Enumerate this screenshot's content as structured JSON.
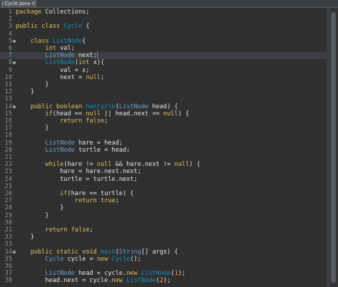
{
  "tab": {
    "title": "Cycle.java",
    "close_glyph": "✕"
  },
  "editor": {
    "current_line": 7,
    "lines": [
      {
        "n": "1",
        "fold": false,
        "tokens": [
          [
            "kw",
            "package"
          ],
          [
            "vr",
            " Collections;"
          ]
        ]
      },
      {
        "n": "2",
        "fold": false,
        "tokens": []
      },
      {
        "n": "3",
        "fold": false,
        "tokens": [
          [
            "kw",
            "public class"
          ],
          [
            "vr",
            " "
          ],
          [
            "cls",
            "Cycle"
          ],
          [
            "vr",
            " {"
          ]
        ]
      },
      {
        "n": "4",
        "fold": false,
        "tokens": []
      },
      {
        "n": "5",
        "fold": true,
        "tokens": [
          [
            "vr",
            "    "
          ],
          [
            "kw",
            "class"
          ],
          [
            "vr",
            " "
          ],
          [
            "cls",
            "ListNode"
          ],
          [
            "vr",
            "{"
          ]
        ]
      },
      {
        "n": "6",
        "fold": false,
        "tokens": [
          [
            "vr",
            "        "
          ],
          [
            "kw",
            "int"
          ],
          [
            "vr",
            " val;"
          ]
        ]
      },
      {
        "n": "7",
        "fold": false,
        "tokens": [
          [
            "vr",
            "        "
          ],
          [
            "ty",
            "ListNode"
          ],
          [
            "vr",
            " next;"
          ]
        ]
      },
      {
        "n": "8",
        "fold": true,
        "tokens": [
          [
            "vr",
            "        "
          ],
          [
            "cls",
            "ListNode"
          ],
          [
            "vr",
            "("
          ],
          [
            "kw",
            "int"
          ],
          [
            "vr",
            " x){"
          ]
        ]
      },
      {
        "n": "9",
        "fold": false,
        "tokens": [
          [
            "vr",
            "            val = x;"
          ]
        ]
      },
      {
        "n": "10",
        "fold": false,
        "tokens": [
          [
            "vr",
            "            next = "
          ],
          [
            "kw",
            "null"
          ],
          [
            "vr",
            ";"
          ]
        ]
      },
      {
        "n": "11",
        "fold": false,
        "tokens": [
          [
            "vr",
            "        }"
          ]
        ]
      },
      {
        "n": "12",
        "fold": false,
        "tokens": [
          [
            "vr",
            "    }"
          ]
        ]
      },
      {
        "n": "13",
        "fold": false,
        "tokens": []
      },
      {
        "n": "14",
        "fold": true,
        "tokens": [
          [
            "vr",
            "    "
          ],
          [
            "kw",
            "public boolean"
          ],
          [
            "vr",
            " "
          ],
          [
            "cls",
            "hasCycle"
          ],
          [
            "vr",
            "("
          ],
          [
            "ty",
            "ListNode"
          ],
          [
            "vr",
            " head) {"
          ]
        ]
      },
      {
        "n": "15",
        "fold": false,
        "tokens": [
          [
            "vr",
            "        "
          ],
          [
            "kw",
            "if"
          ],
          [
            "vr",
            "(head == "
          ],
          [
            "kw",
            "null"
          ],
          [
            "vr",
            " || head.next == "
          ],
          [
            "kw",
            "null"
          ],
          [
            "vr",
            ") {"
          ]
        ]
      },
      {
        "n": "16",
        "fold": false,
        "tokens": [
          [
            "vr",
            "            "
          ],
          [
            "kw",
            "return false"
          ],
          [
            "vr",
            ";"
          ]
        ]
      },
      {
        "n": "17",
        "fold": false,
        "tokens": [
          [
            "vr",
            "        }"
          ]
        ]
      },
      {
        "n": "18",
        "fold": false,
        "tokens": []
      },
      {
        "n": "19",
        "fold": false,
        "tokens": [
          [
            "vr",
            "        "
          ],
          [
            "ty",
            "ListNode"
          ],
          [
            "vr",
            " hare = head;"
          ]
        ]
      },
      {
        "n": "20",
        "fold": false,
        "tokens": [
          [
            "vr",
            "        "
          ],
          [
            "ty",
            "ListNode"
          ],
          [
            "vr",
            " turtle = head;"
          ]
        ]
      },
      {
        "n": "21",
        "fold": false,
        "tokens": []
      },
      {
        "n": "22",
        "fold": false,
        "tokens": [
          [
            "vr",
            "        "
          ],
          [
            "kw",
            "while"
          ],
          [
            "vr",
            "(hare != "
          ],
          [
            "kw",
            "null"
          ],
          [
            "vr",
            " && hare.next != "
          ],
          [
            "kw",
            "null"
          ],
          [
            "vr",
            ") {"
          ]
        ]
      },
      {
        "n": "23",
        "fold": false,
        "tokens": [
          [
            "vr",
            "            hare = hare.next.next;"
          ]
        ]
      },
      {
        "n": "24",
        "fold": false,
        "tokens": [
          [
            "vr",
            "            turtle = turtle.next;"
          ]
        ]
      },
      {
        "n": "25",
        "fold": false,
        "tokens": []
      },
      {
        "n": "26",
        "fold": false,
        "tokens": [
          [
            "vr",
            "            "
          ],
          [
            "kw",
            "if"
          ],
          [
            "vr",
            "(hare == turtle) {"
          ]
        ]
      },
      {
        "n": "27",
        "fold": false,
        "tokens": [
          [
            "vr",
            "                "
          ],
          [
            "kw",
            "return true"
          ],
          [
            "vr",
            ";"
          ]
        ]
      },
      {
        "n": "28",
        "fold": false,
        "tokens": [
          [
            "vr",
            "            }"
          ]
        ]
      },
      {
        "n": "29",
        "fold": false,
        "tokens": [
          [
            "vr",
            "        }"
          ]
        ]
      },
      {
        "n": "30",
        "fold": false,
        "tokens": []
      },
      {
        "n": "31",
        "fold": false,
        "tokens": [
          [
            "vr",
            "        "
          ],
          [
            "kw",
            "return false"
          ],
          [
            "vr",
            ";"
          ]
        ]
      },
      {
        "n": "32",
        "fold": false,
        "tokens": [
          [
            "vr",
            "    }"
          ]
        ]
      },
      {
        "n": "33",
        "fold": false,
        "tokens": []
      },
      {
        "n": "34",
        "fold": true,
        "tokens": [
          [
            "vr",
            "    "
          ],
          [
            "kw",
            "public static void"
          ],
          [
            "vr",
            " "
          ],
          [
            "cls",
            "main"
          ],
          [
            "vr",
            "("
          ],
          [
            "ty",
            "String"
          ],
          [
            "vr",
            "[] args) {"
          ]
        ]
      },
      {
        "n": "35",
        "fold": false,
        "tokens": [
          [
            "vr",
            "        "
          ],
          [
            "ty",
            "Cycle"
          ],
          [
            "vr",
            " cycle = "
          ],
          [
            "kw",
            "new"
          ],
          [
            "vr",
            " "
          ],
          [
            "cls",
            "Cycle"
          ],
          [
            "vr",
            "();"
          ]
        ]
      },
      {
        "n": "36",
        "fold": false,
        "tokens": []
      },
      {
        "n": "37",
        "fold": false,
        "tokens": [
          [
            "vr",
            "        "
          ],
          [
            "ty",
            "ListNode"
          ],
          [
            "vr",
            " head = cycle."
          ],
          [
            "kw",
            "new"
          ],
          [
            "vr",
            " "
          ],
          [
            "cls",
            "ListNode"
          ],
          [
            "vr",
            "("
          ],
          [
            "lit",
            "1"
          ],
          [
            "vr",
            ");"
          ]
        ]
      },
      {
        "n": "38",
        "fold": false,
        "tokens": [
          [
            "vr",
            "        head.next = cycle."
          ],
          [
            "kw",
            "new"
          ],
          [
            "vr",
            " "
          ],
          [
            "cls",
            "ListNode"
          ],
          [
            "vr",
            "("
          ],
          [
            "lit",
            "2"
          ],
          [
            "vr",
            ");"
          ]
        ]
      }
    ]
  }
}
